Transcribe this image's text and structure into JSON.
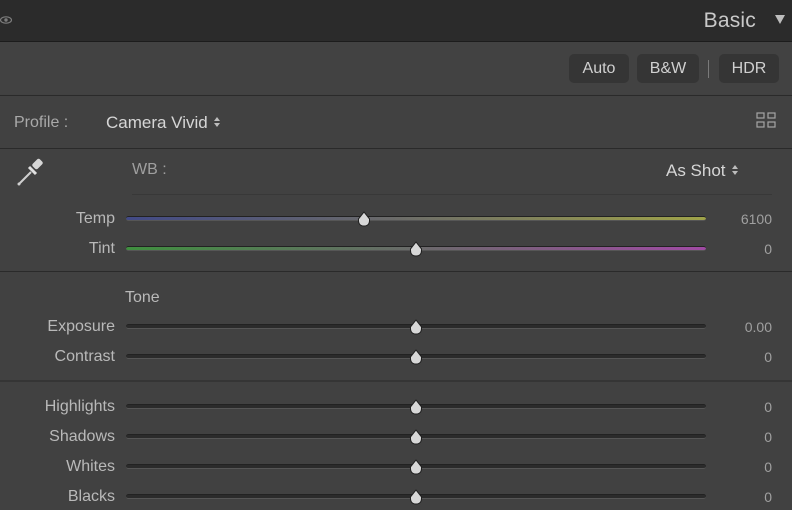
{
  "header": {
    "title": "Basic"
  },
  "toolbar": {
    "auto": "Auto",
    "bw": "B&W",
    "hdr": "HDR"
  },
  "profile": {
    "label": "Profile :",
    "value": "Camera Vivid"
  },
  "wb": {
    "label": "WB :",
    "value": "As Shot"
  },
  "sliders": {
    "temp": {
      "label": "Temp",
      "value": "6100",
      "level": 0.41
    },
    "tint": {
      "label": "Tint",
      "value": "0",
      "level": 0.5
    },
    "exposure": {
      "label": "Exposure",
      "value": "0.00",
      "level": 0.5
    },
    "contrast": {
      "label": "Contrast",
      "value": "0",
      "level": 0.5
    },
    "highlights": {
      "label": "Highlights",
      "value": "0",
      "level": 0.5
    },
    "shadows": {
      "label": "Shadows",
      "value": "0",
      "level": 0.5
    },
    "whites": {
      "label": "Whites",
      "value": "0",
      "level": 0.5
    },
    "blacks": {
      "label": "Blacks",
      "value": "0",
      "level": 0.5
    }
  },
  "tone": {
    "title": "Tone"
  },
  "icons": {
    "eye": "eye-icon",
    "collapse": "triangle-down-icon",
    "grid": "grid-icon",
    "dropper": "eyedropper-icon"
  },
  "colors": {
    "panel_bg": "#414141",
    "header_bg": "#2b2b2b",
    "button_bg": "#353535",
    "temp_cool": "#424a86",
    "temp_warm": "#9fa349",
    "tint_green": "#3f8f3f",
    "tint_magenta": "#a04aa4"
  }
}
